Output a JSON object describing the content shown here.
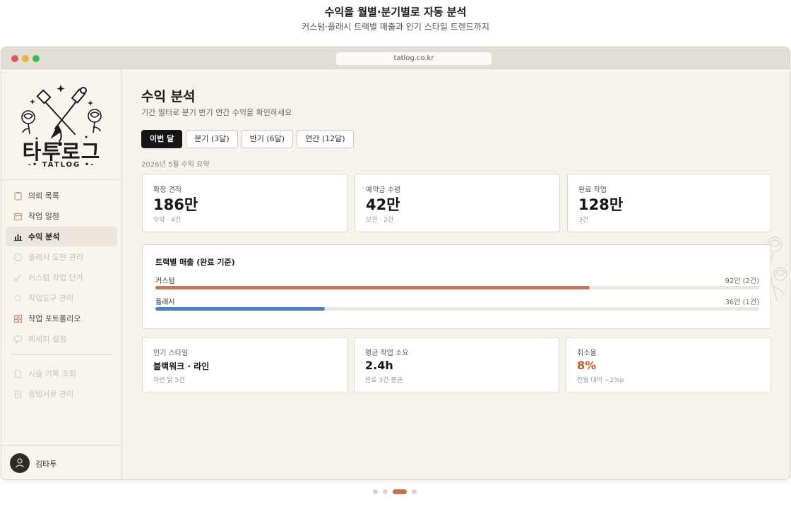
{
  "headline": "수익을 월별·분기별로 자동 분석",
  "subheadline": "커스텀·플래시 트랙별 매출과 인기 스타일 트렌드까지",
  "browser": {
    "url": "tatlog.co.kr"
  },
  "brand": {
    "name": "타투로그",
    "sub": "-• TATLOG •-"
  },
  "sidebar": {
    "items": [
      {
        "label": "의뢰 목록",
        "icon": "clipboard-icon",
        "state": "normal"
      },
      {
        "label": "작업 일정",
        "icon": "calendar-icon",
        "state": "normal"
      },
      {
        "label": "수익 분석",
        "icon": "bar-chart-icon",
        "state": "active"
      },
      {
        "label": "플래시 도안 관리",
        "icon": "palette-icon",
        "state": "disabled"
      },
      {
        "label": "커스텀 작업 단가",
        "icon": "scissors-icon",
        "state": "disabled"
      },
      {
        "label": "작업도구 관리",
        "icon": "gear-icon",
        "state": "disabled"
      },
      {
        "label": "작업 포트폴리오",
        "icon": "grid-icon",
        "state": "normal"
      },
      {
        "label": "메세지 설정",
        "icon": "message-icon",
        "state": "disabled"
      }
    ],
    "items_secondary": [
      {
        "label": "시술 기록 조회",
        "icon": "document-icon",
        "state": "disabled"
      },
      {
        "label": "증빙서류 관리",
        "icon": "receipt-icon",
        "state": "disabled"
      }
    ],
    "user": {
      "name": "김타투"
    }
  },
  "main": {
    "title": "수익 분석",
    "description": "기간 필터로 분기 반기 연간 수익을 확인하세요",
    "filters": [
      {
        "label": "이번 달",
        "active": true
      },
      {
        "label": "분기 (3달)",
        "active": false
      },
      {
        "label": "반기 (6달)",
        "active": false
      },
      {
        "label": "연간 (12달)",
        "active": false
      }
    ],
    "summary_caption": "2026년 5월 수익 요약",
    "summary_cards": [
      {
        "label": "확정 견적",
        "value": "186만",
        "sub": "수락 · 4건"
      },
      {
        "label": "예약금 수령",
        "value": "42만",
        "sub": "보관 · 2건"
      },
      {
        "label": "완료 작업",
        "value": "128만",
        "sub": "3건"
      }
    ],
    "track_section": {
      "title": "트랙별 매출 (완료 기준)",
      "tracks": [
        {
          "name": "커스텀",
          "amount": "92만 (2건)",
          "value": 92,
          "color": "#c07a58"
        },
        {
          "name": "플래시",
          "amount": "36만 (1건)",
          "value": 36,
          "color": "#4a7fc4"
        }
      ],
      "scale_max": 128
    },
    "stat_cards": [
      {
        "label": "인기 스타일",
        "value": "블랙워크 · 라인",
        "sub": "이번 달 5건"
      },
      {
        "label": "평균 작업 소요",
        "value": "2.4h",
        "sub": "완료 3건 평균"
      },
      {
        "label": "취소율",
        "value": "8%",
        "sub": "전월 대비 −2%p"
      }
    ]
  },
  "pager": {
    "count": 4,
    "active_index": 2
  },
  "colors": {
    "accent": "#c3582b",
    "custom_track": "#c07a58",
    "flash_track": "#4a7fc4",
    "active_filter": "#151515"
  }
}
